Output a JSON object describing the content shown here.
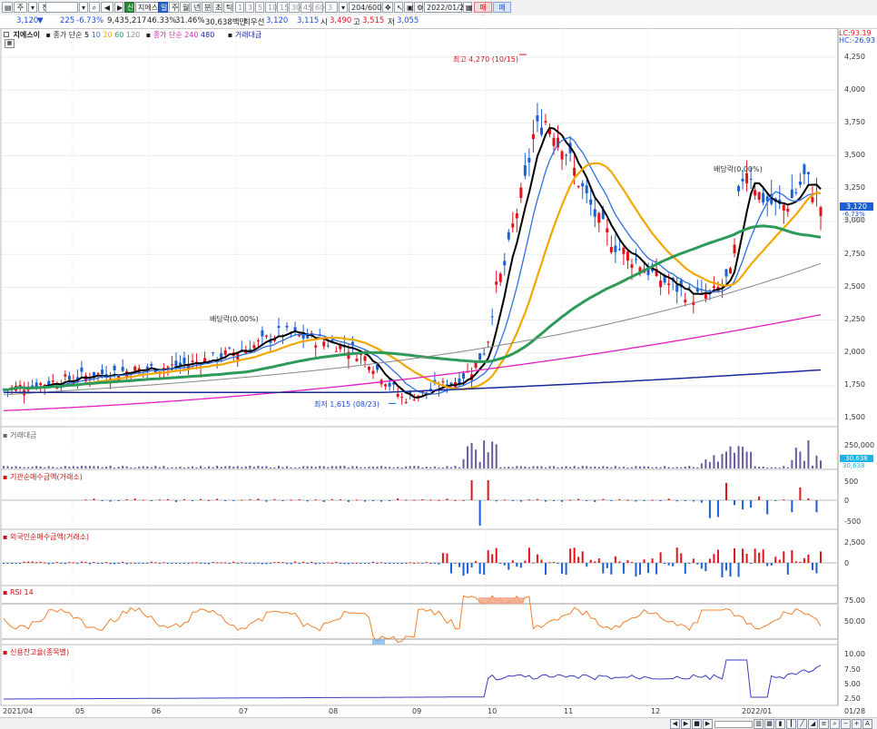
{
  "toolbar": {
    "market_label": "주",
    "prev_label": "전",
    "code": "A3059",
    "stock_name": "지에스이",
    "period_tabs": [
      "일",
      "주",
      "월",
      "년",
      "분",
      "초",
      "틱"
    ],
    "intervals": [
      "1",
      "3",
      "5",
      "10",
      "15",
      "30",
      "45",
      "60"
    ],
    "interval_value": "3",
    "count": "204/600",
    "date": "2022/01/28",
    "buy_label": "매수",
    "sell_label": "매도"
  },
  "quote": {
    "price": "3,120",
    "arrow": "▼",
    "change": "225",
    "change_pct": "-6.73%",
    "volume": "9,435,217",
    "vol_ratio": "46.33%",
    "turnover": "31.46%",
    "amount": "30,638백만",
    "best_bid_label": "최우선",
    "best_ask": "3,120",
    "best_bid": "3,115",
    "open_label": "시",
    "open": "3,490",
    "high_label": "고",
    "high": "3,515",
    "low_label": "저",
    "low": "3,055"
  },
  "legend": {
    "name": "지에스이",
    "ma_label": "종가 단순",
    "ma_periods": [
      "5",
      "10",
      "20",
      "60",
      "120"
    ],
    "ma2_label": "종가 단순",
    "ma2_periods": [
      "240",
      "480"
    ],
    "vol_label": "거래대금",
    "lc": "LC:93.19",
    "hc": "HC:-26.93"
  },
  "annotations": {
    "high_mark": "최고 4,270 (10/15)",
    "low_mark": "최저 1,615 (08/23)",
    "dividend1": "배당락(0.00%)",
    "dividend2": "배당락(0.00%)"
  },
  "price_axis": {
    "ticks": [
      "4,250",
      "4,000",
      "3,750",
      "3,500",
      "3,250",
      "3,000",
      "2,750",
      "2,500",
      "2,250",
      "2,000",
      "1,750",
      "1,500"
    ],
    "current_price": "3,120",
    "current_pct": "-6.73%",
    "current_extra": "-6.73%"
  },
  "panels": {
    "volume": {
      "label": "거래대금",
      "ticks": [
        "250,000"
      ],
      "current": "30,638",
      "current2": "30,638"
    },
    "inst": {
      "label": "기관순매수금액(거래소)",
      "ticks": [
        "500",
        "0",
        "-500"
      ]
    },
    "foreign": {
      "label": "외국인순매수금액(거래소)",
      "ticks": [
        "2,500",
        "0"
      ]
    },
    "rsi": {
      "label": "RSI 14",
      "ticks": [
        "75.00",
        "50.00"
      ]
    },
    "credit": {
      "label": "신용잔고율(종목별)",
      "ticks": [
        "10.00",
        "7.50",
        "5.00",
        "2.50"
      ]
    }
  },
  "x_axis": {
    "labels": [
      "2021/04",
      "05",
      "06",
      "07",
      "08",
      "09",
      "10",
      "11",
      "12",
      "2022/01"
    ],
    "right_label": "01/28"
  },
  "colors": {
    "up": "#e0121a",
    "down": "#1b5fd0",
    "ma5": "#000000",
    "ma10": "#2f6fe0",
    "ma20": "#f0a800",
    "ma60": "#2e9a5a",
    "ma120": "#888888",
    "ma240": "#e020c0",
    "ma480": "#1a2a9a",
    "rsi": "#f08030"
  }
}
